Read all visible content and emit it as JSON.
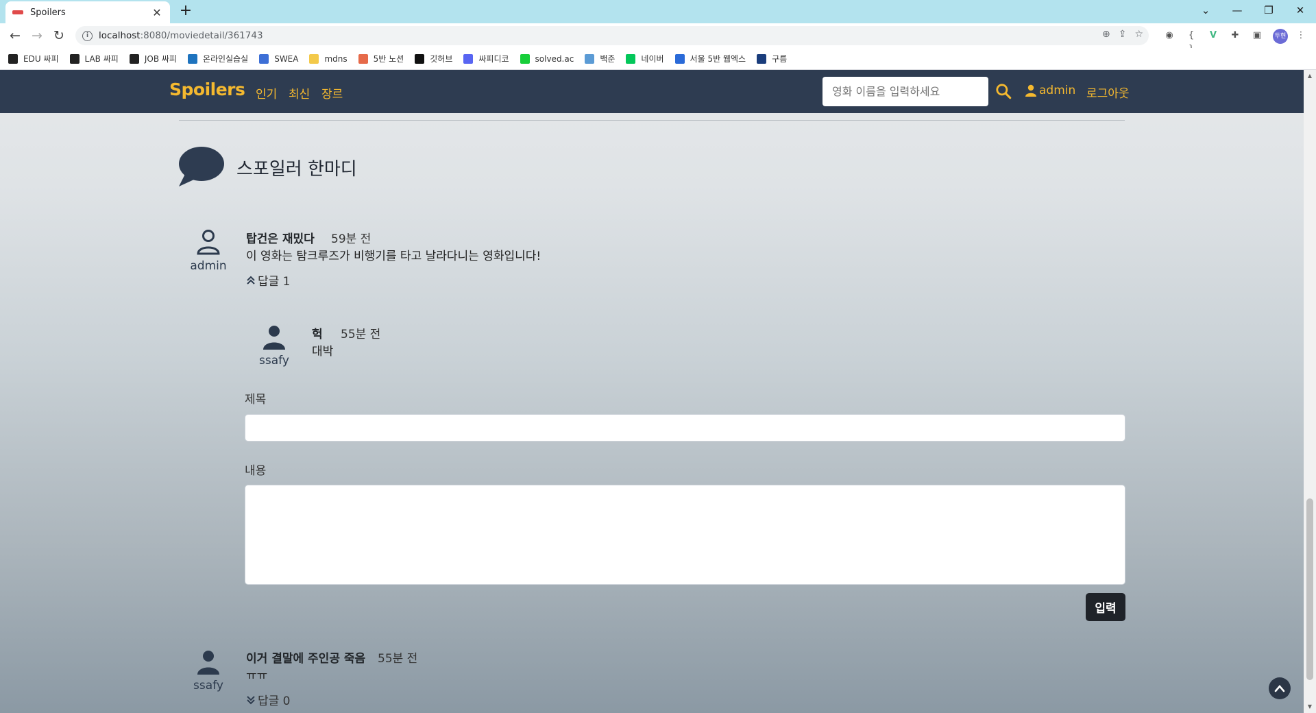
{
  "browser": {
    "tab_title": "Spoilers",
    "url_host": "localhost",
    "url_path": ":8080/moviedetail/361743",
    "profile_initials": "두현",
    "bookmarks": [
      {
        "label": "EDU 싸피",
        "color": "#222222"
      },
      {
        "label": "LAB 싸피",
        "color": "#222222"
      },
      {
        "label": "JOB 싸피",
        "color": "#222222"
      },
      {
        "label": "온라인실습실",
        "color": "#1e73be"
      },
      {
        "label": "SWEA",
        "color": "#3d6fd6"
      },
      {
        "label": "mdns",
        "color": "#f3c94a"
      },
      {
        "label": "5반 노션",
        "color": "#e66a4a"
      },
      {
        "label": "깃허브",
        "color": "#111111"
      },
      {
        "label": "싸피디코",
        "color": "#5865f2"
      },
      {
        "label": "solved.ac",
        "color": "#17ce3a"
      },
      {
        "label": "백준",
        "color": "#5b9bd5"
      },
      {
        "label": "네이버",
        "color": "#03c75a"
      },
      {
        "label": "서울 5반 웹엑스",
        "color": "#2a6ad8"
      },
      {
        "label": "구름",
        "color": "#1a3d7c"
      }
    ]
  },
  "nav": {
    "brand": "Spoilers",
    "links": [
      "인기",
      "최신",
      "장르"
    ],
    "search_placeholder": "영화 이름을 입력하세요",
    "username": "admin",
    "logout": "로그아웃"
  },
  "section": {
    "title": "스포일러 한마디"
  },
  "comments": [
    {
      "user": "admin",
      "title": "탑건은 재밌다",
      "time": "59분 전",
      "body": "이 영화는 탐크루즈가 비행기를 타고 날라다니는 영화입니다!",
      "reply_label": "답글 1",
      "replies": [
        {
          "user": "ssafy",
          "title": "헉",
          "time": "55분 전",
          "body": "대박"
        }
      ]
    },
    {
      "user": "ssafy",
      "title": "이거 결말에 주인공 죽음",
      "time": "55분 전",
      "body": "ㅠㅠ",
      "reply_label": "답글 0"
    }
  ],
  "form": {
    "title_label": "제목",
    "content_label": "내용",
    "submit": "입력"
  }
}
